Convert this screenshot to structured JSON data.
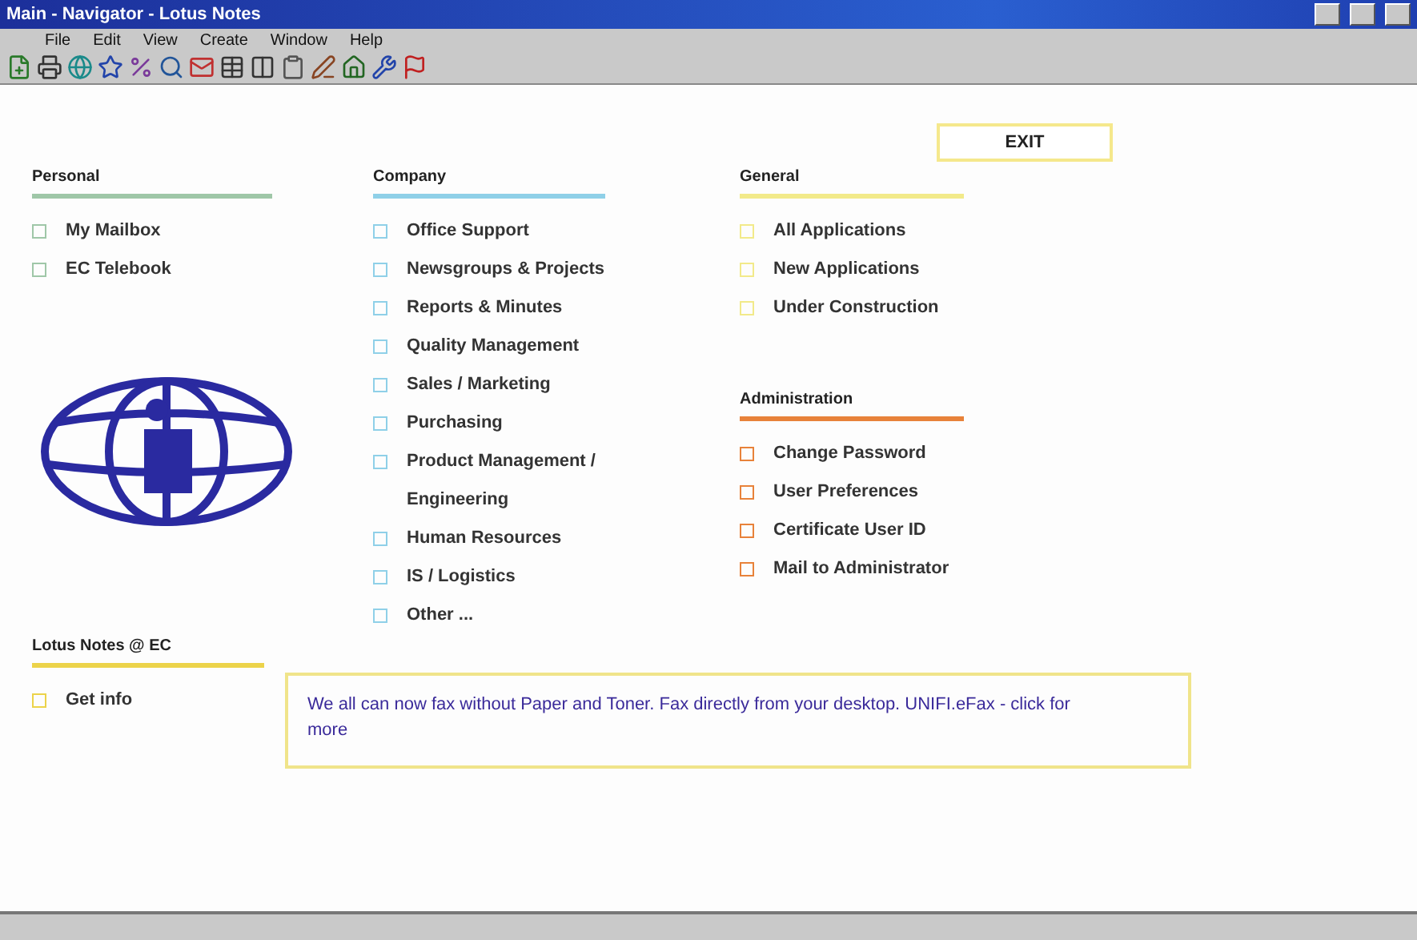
{
  "window": {
    "title": "Main - Navigator - Lotus Notes"
  },
  "menu": [
    "File",
    "Edit",
    "View",
    "Create",
    "Window",
    "Help"
  ],
  "exit_button": "EXIT",
  "sections": [
    {
      "title": "Personal",
      "color": "#9fc7a8",
      "items": [
        "My Mailbox",
        "EC Telebook"
      ]
    },
    {
      "title": "Company",
      "color": "#8fd0e8",
      "items": [
        "Office Support",
        "Newsgroups & Projects",
        "Reports & Minutes",
        "Quality Management",
        "Sales / Marketing",
        "Purchasing",
        "Product Management / Engineering",
        "Human Resources",
        "IS / Logistics",
        "Other ..."
      ]
    },
    {
      "title": "General",
      "color": "#f2ea8a",
      "items": [
        "All Applications",
        "New Applications",
        "Under Construction"
      ]
    },
    {
      "title": "Administration",
      "color": "#e8823a",
      "items": [
        "Change Password",
        "User Preferences",
        "Certificate User ID",
        "Mail to Administrator"
      ]
    },
    {
      "title": "Lotus Notes @ EC",
      "color": "#ecd34a",
      "items": [
        "Get info"
      ]
    }
  ],
  "banner": "We all can now fax without Paper and Toner. Fax directly from your desktop. UNIFI.eFax - click for more"
}
